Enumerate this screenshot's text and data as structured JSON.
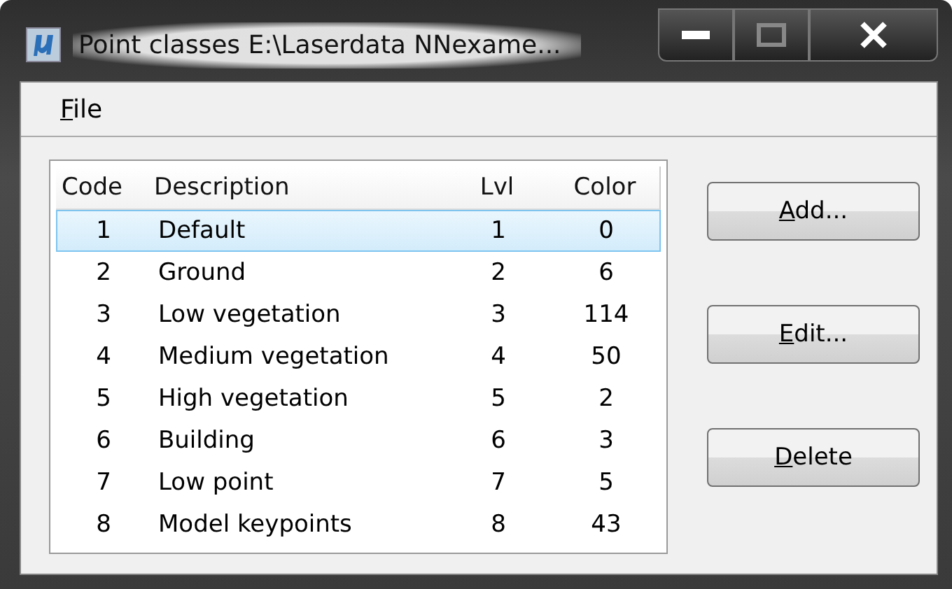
{
  "window": {
    "title": "Point classes E:\\Laserdata NNexame..."
  },
  "menu": [
    {
      "label": "File",
      "underline_first": true
    }
  ],
  "table": {
    "columns": [
      "Code",
      "Description",
      "Lvl",
      "Color"
    ],
    "rows": [
      {
        "cells": [
          "1",
          "Default",
          "1",
          "0"
        ],
        "selected": true
      },
      {
        "cells": [
          "2",
          "Ground",
          "2",
          "6"
        ],
        "selected": false
      },
      {
        "cells": [
          "3",
          "Low vegetation",
          "3",
          "114"
        ],
        "selected": false
      },
      {
        "cells": [
          "4",
          "Medium vegetation",
          "4",
          "50"
        ],
        "selected": false
      },
      {
        "cells": [
          "5",
          "High vegetation",
          "5",
          "2"
        ],
        "selected": false
      },
      {
        "cells": [
          "6",
          "Building",
          "6",
          "3"
        ],
        "selected": false
      },
      {
        "cells": [
          "7",
          "Low point",
          "7",
          "5"
        ],
        "selected": false
      },
      {
        "cells": [
          "8",
          "Model keypoints",
          "8",
          "43"
        ],
        "selected": false
      }
    ]
  },
  "buttons": [
    {
      "label": "Add...",
      "underline_first": true
    },
    {
      "label": "Edit...",
      "underline_first": true
    },
    {
      "label": "Delete",
      "underline_first": true
    }
  ]
}
